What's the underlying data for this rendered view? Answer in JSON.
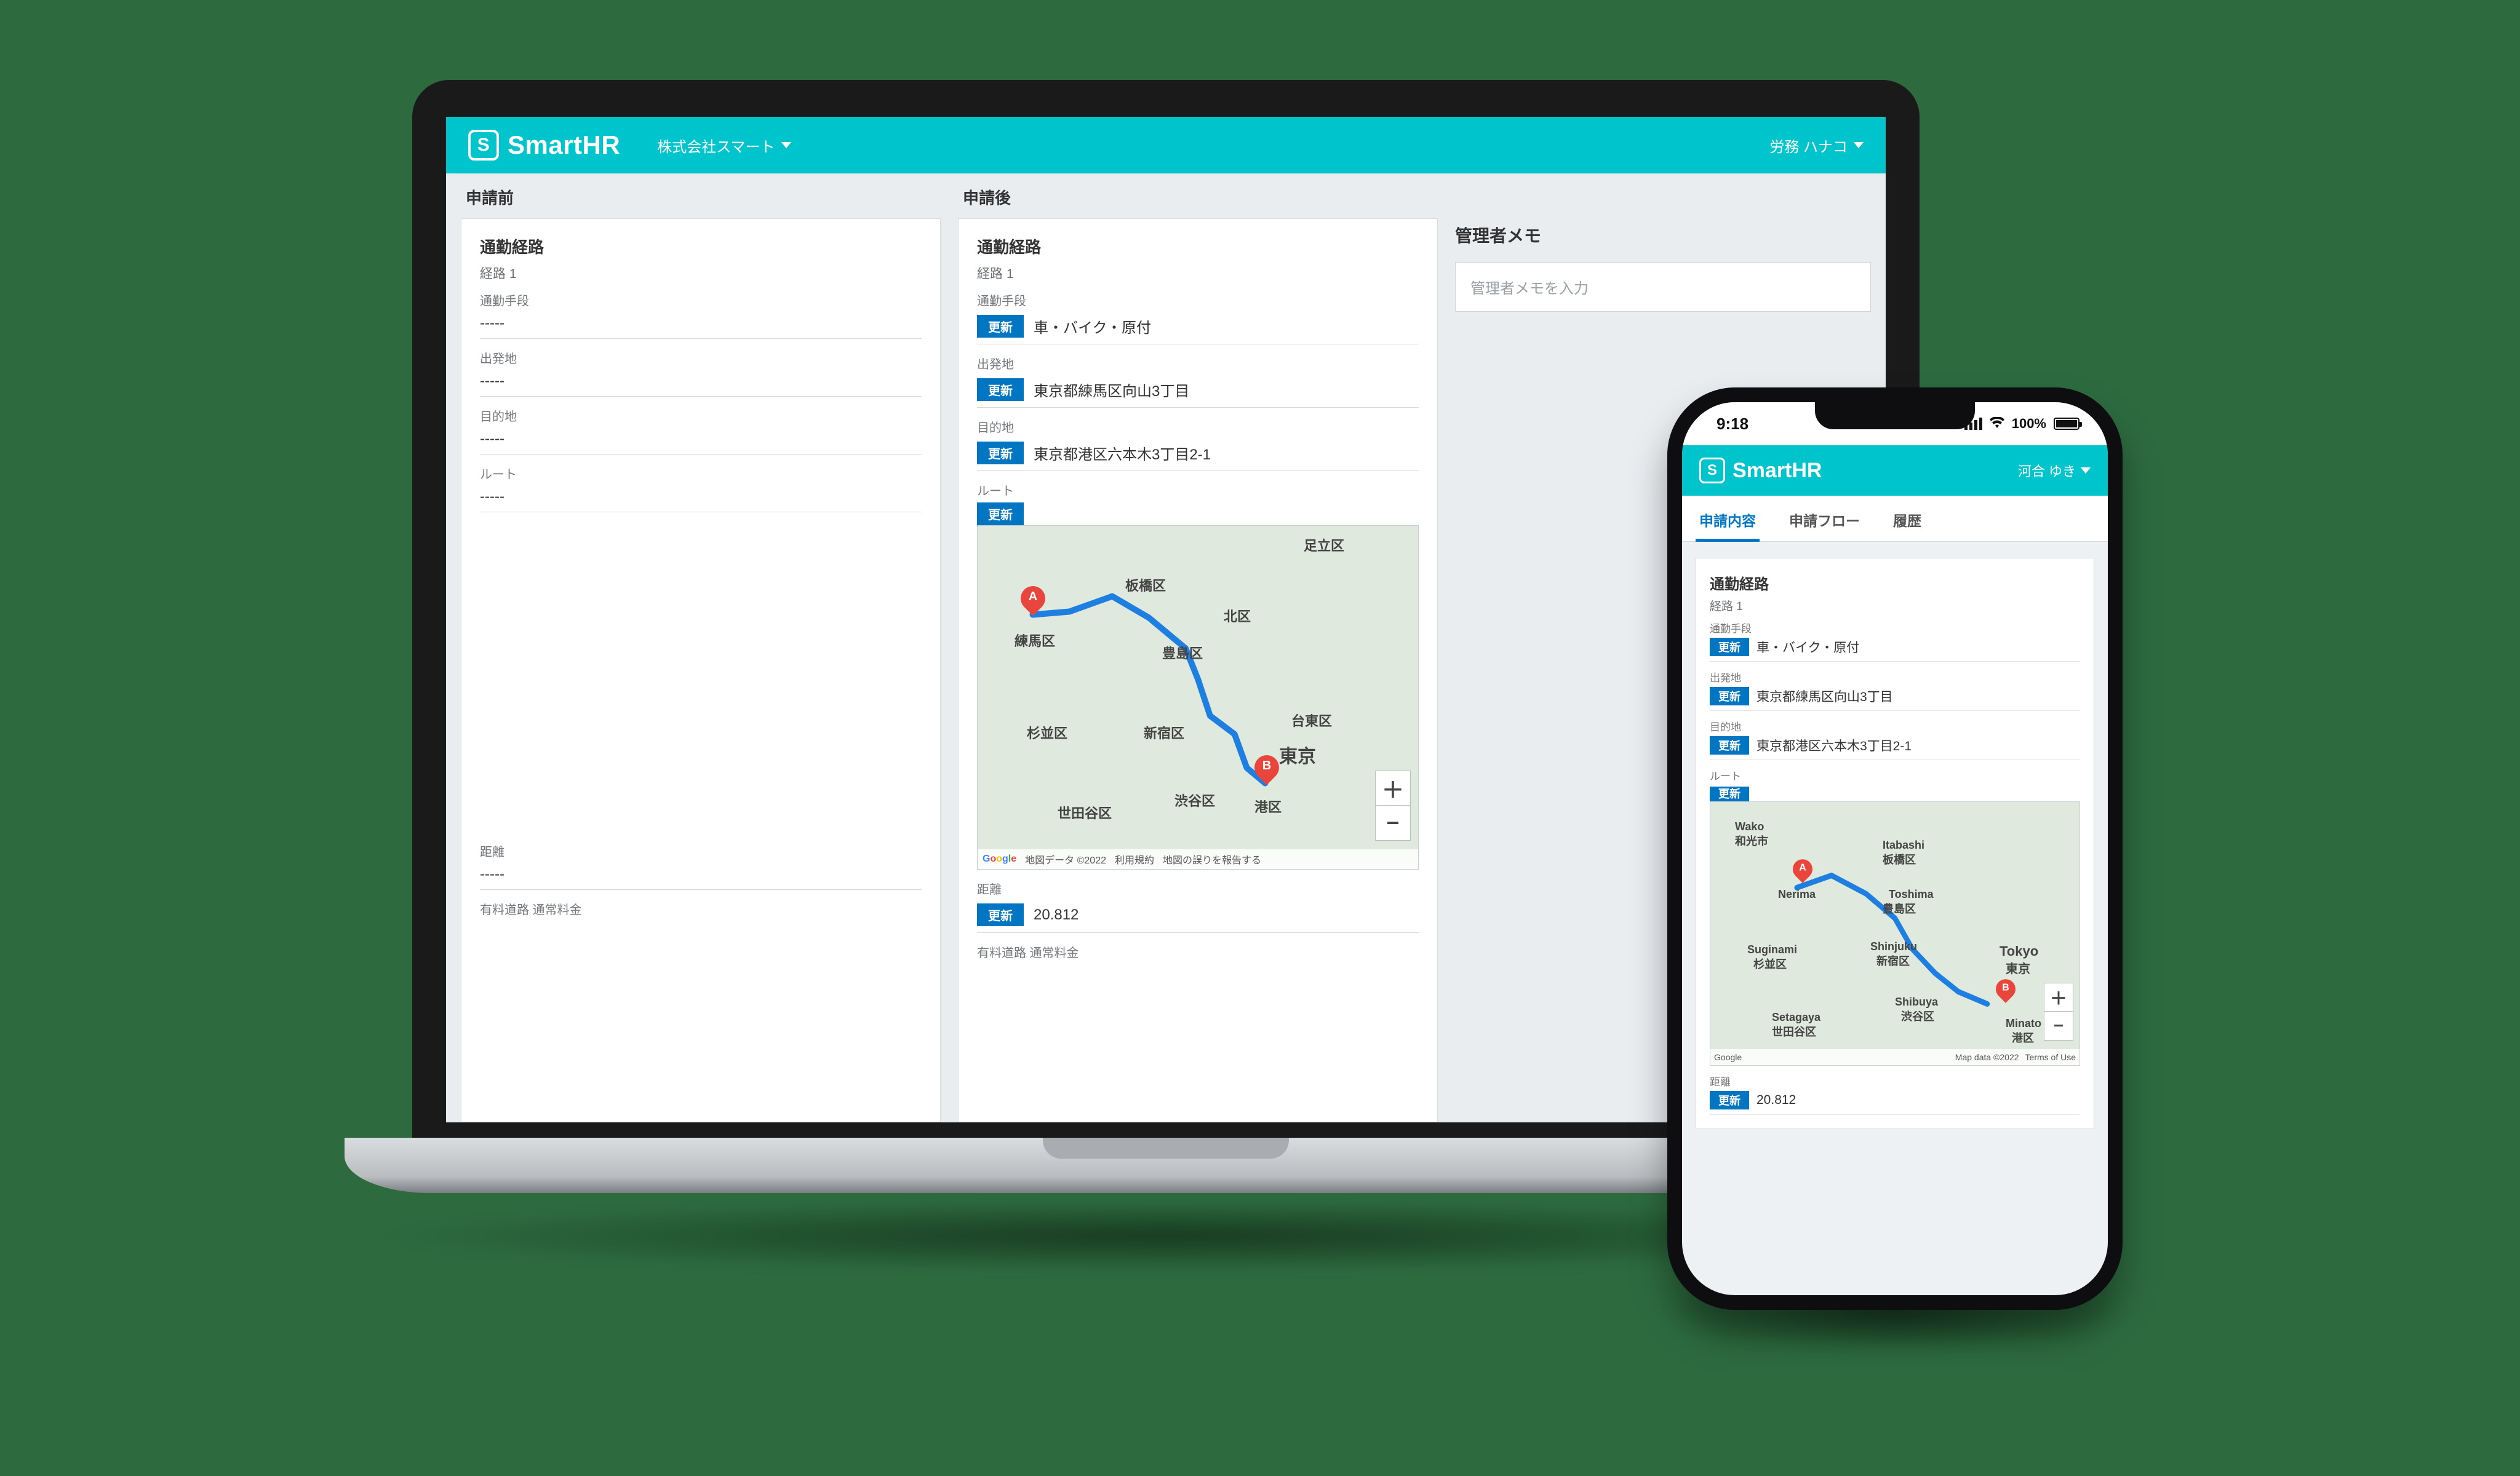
{
  "brand": "SmartHR",
  "desktop": {
    "company": "株式会社スマート",
    "user": "労務 ハナコ",
    "columns": {
      "before_title": "申請前",
      "after_title": "申請後"
    },
    "section_title": "通勤経路",
    "route_label": "経路 1",
    "empty": "-----",
    "update_badge": "更新",
    "fields": {
      "method": {
        "label": "通勤手段",
        "after": "車・バイク・原付"
      },
      "origin": {
        "label": "出発地",
        "after": "東京都練馬区向山3丁目"
      },
      "dest": {
        "label": "目的地",
        "after": "東京都港区六本木3丁目2-1"
      },
      "route": {
        "label": "ルート"
      },
      "distance": {
        "label": "距離",
        "after": "20.812"
      },
      "toll": {
        "label": "有料道路 通常料金"
      }
    },
    "map": {
      "wards": {
        "nerima": "練馬区",
        "itabashi": "板橋区",
        "kita": "北区",
        "toshima": "豊島区",
        "suginami": "杉並区",
        "shinjuku": "新宿区",
        "taitou": "台東区",
        "tokyo": "東京",
        "setagaya": "世田谷区",
        "shibuya": "渋谷区",
        "minato": "港区",
        "adachi": "足立区"
      },
      "pin_a": "A",
      "pin_b": "B",
      "plus": "＋",
      "minus": "−",
      "attrib_data": "地図データ ©2022",
      "attrib_terms": "利用規約",
      "attrib_report": "地図の誤りを報告する"
    },
    "memo": {
      "title": "管理者メモ",
      "placeholder": "管理者メモを入力"
    }
  },
  "phone": {
    "time": "9:18",
    "battery": "100%",
    "user": "河合 ゆき",
    "tabs": {
      "content": "申請内容",
      "flow": "申請フロー",
      "history": "履歴"
    },
    "section_title": "通勤経路",
    "route_label": "経路 1",
    "update_badge": "更新",
    "fields": {
      "method": {
        "label": "通勤手段",
        "value": "車・バイク・原付"
      },
      "origin": {
        "label": "出発地",
        "value": "東京都練馬区向山3丁目"
      },
      "dest": {
        "label": "目的地",
        "value": "東京都港区六本木3丁目2-1"
      },
      "route": {
        "label": "ルート"
      },
      "distance": {
        "label": "距離",
        "value": "20.812"
      }
    },
    "map": {
      "wards": {
        "nerima": "Nerima",
        "itabashi": "Itabashi",
        "itabashi_jp": "板橋区",
        "toshima": "Toshima",
        "toshima_jp": "豊島区",
        "suginami": "Suginami",
        "suginami_jp": "杉並区",
        "shinjuku": "Shinjuku",
        "shinjuku_jp": "新宿区",
        "tokyo": "Tokyo",
        "tokyo_jp": "東京",
        "setagaya": "Setagaya",
        "setagaya_jp": "世田谷区",
        "shibuya": "Shibuya",
        "shibuya_jp": "渋谷区",
        "minato": "Minato",
        "minato_jp": "港区",
        "wako": "Wako",
        "wako_jp": "和光市"
      },
      "pin_a": "A",
      "pin_b": "B",
      "plus": "＋",
      "minus": "−",
      "attrib_data": "Map data ©2022",
      "attrib_terms": "Terms of Use"
    }
  }
}
